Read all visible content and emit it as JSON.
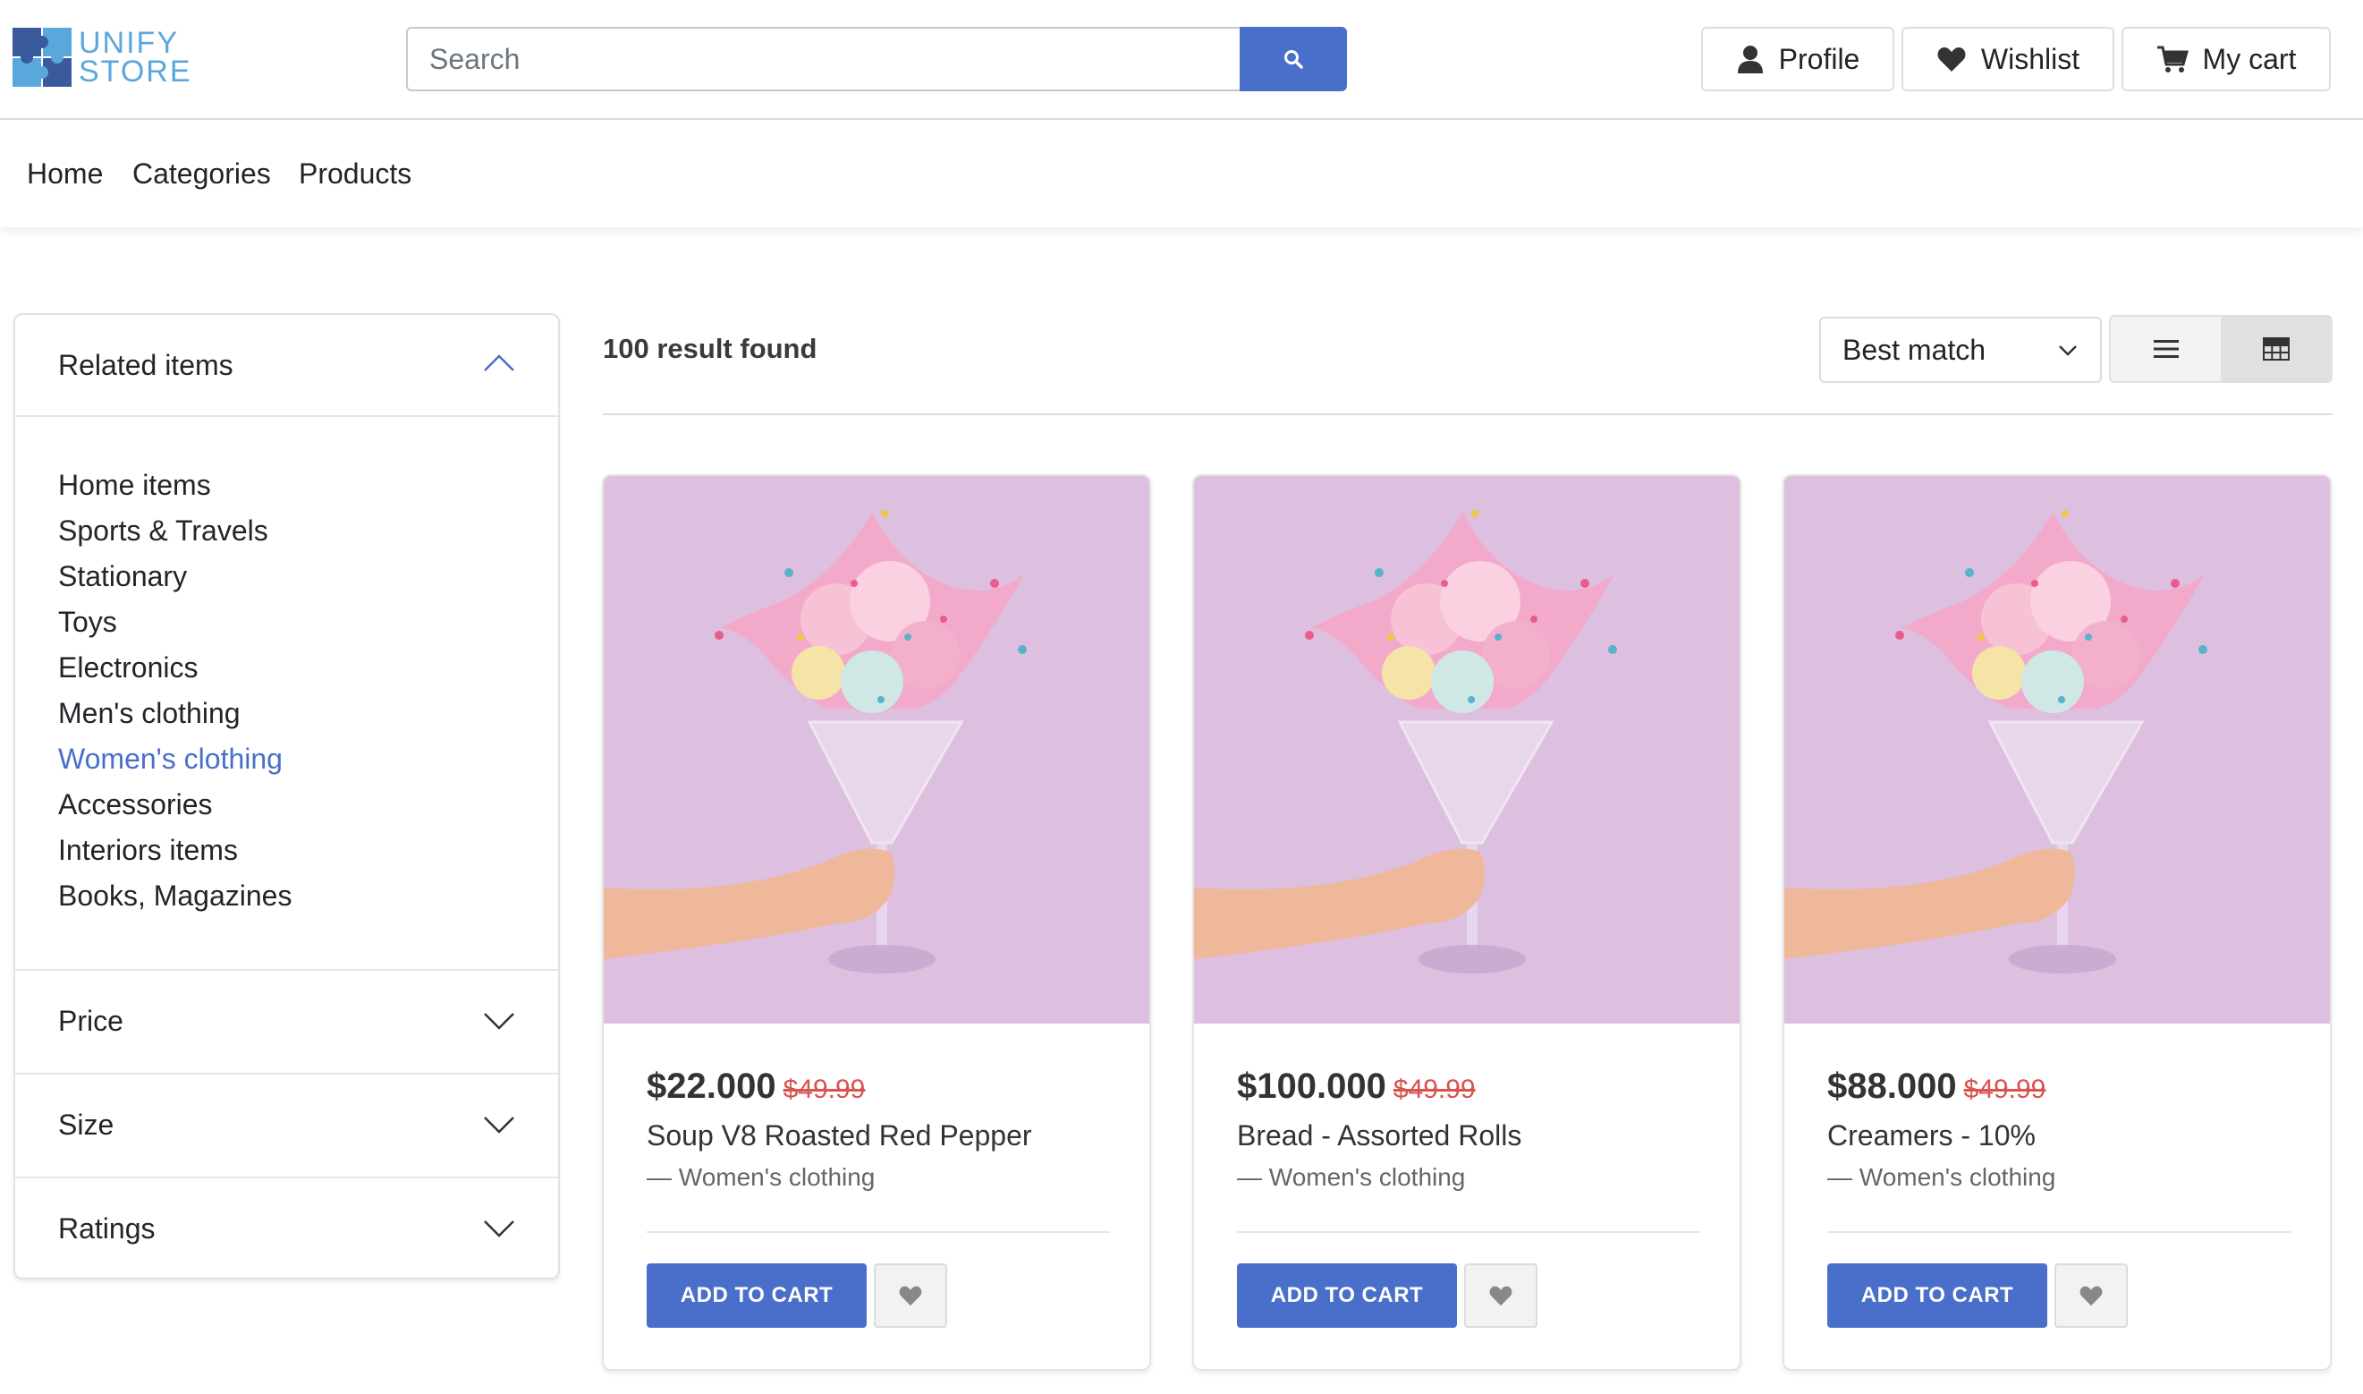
{
  "brand": {
    "line1": "UNIFY",
    "line2": "STORE"
  },
  "header": {
    "search_placeholder": "Search",
    "profile_label": "Profile",
    "wishlist_label": "Wishlist",
    "cart_label": "My cart"
  },
  "nav": {
    "items": [
      "Home",
      "Categories",
      "Products"
    ]
  },
  "sidebar": {
    "related_title": "Related items",
    "categories": [
      "Home items",
      "Sports & Travels",
      "Stationary",
      "Toys",
      "Electronics",
      "Men's clothing",
      "Women's clothing",
      "Accessories",
      "Interiors items",
      "Books, Magazines"
    ],
    "active_category": "Women's clothing",
    "filters": [
      "Price",
      "Size",
      "Ratings"
    ]
  },
  "results": {
    "count_text": "100 result found",
    "sort_value": "Best match"
  },
  "products": [
    {
      "price": "$22.000",
      "old_price": "$49.99",
      "name": "Soup V8 Roasted Red Pepper",
      "category": "— Women's clothing",
      "add_label": "ADD TO CART"
    },
    {
      "price": "$100.000",
      "old_price": "$49.99",
      "name": "Bread - Assorted Rolls",
      "category": "— Women's clothing",
      "add_label": "ADD TO CART"
    },
    {
      "price": "$88.000",
      "old_price": "$49.99",
      "name": "Creamers - 10%",
      "category": "— Women's clothing",
      "add_label": "ADD TO CART"
    }
  ],
  "colors": {
    "accent": "#4a6fcb",
    "sale_price": "#d9534f",
    "image_bg": "#ddbfdf",
    "logo": "#5aa7de"
  },
  "icons": {
    "search": "search-icon",
    "profile": "user-icon",
    "wishlist": "heart-icon",
    "cart": "cart-icon",
    "list_view": "list-icon",
    "grid_view": "grid-icon"
  }
}
